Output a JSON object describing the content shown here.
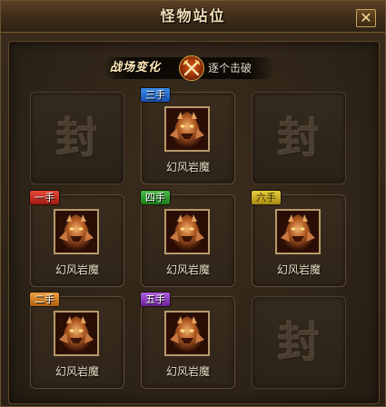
{
  "window": {
    "title": "怪物站位",
    "close_label": "✕"
  },
  "battle_change": {
    "label": "战场变化",
    "icon": "crossed-swords-icon",
    "mode": "逐个击破"
  },
  "seal_glyph": "封",
  "slots": [
    {
      "tag": "三手",
      "tag_color": "#2a6fd0",
      "name": "幻风岩魔"
    },
    {
      "tag": "一手",
      "tag_color": "#c02a20",
      "name": "幻风岩魔"
    },
    {
      "tag": "四手",
      "tag_color": "#2e9a2e",
      "name": "幻风岩魔"
    },
    {
      "tag": "六手",
      "tag_color": "#c8b028",
      "name": "幻风岩魔"
    },
    {
      "tag": "二手",
      "tag_color": "#d88028",
      "name": "幻风岩魔"
    },
    {
      "tag": "五手",
      "tag_color": "#8a3cc0",
      "name": "幻风岩魔"
    }
  ]
}
